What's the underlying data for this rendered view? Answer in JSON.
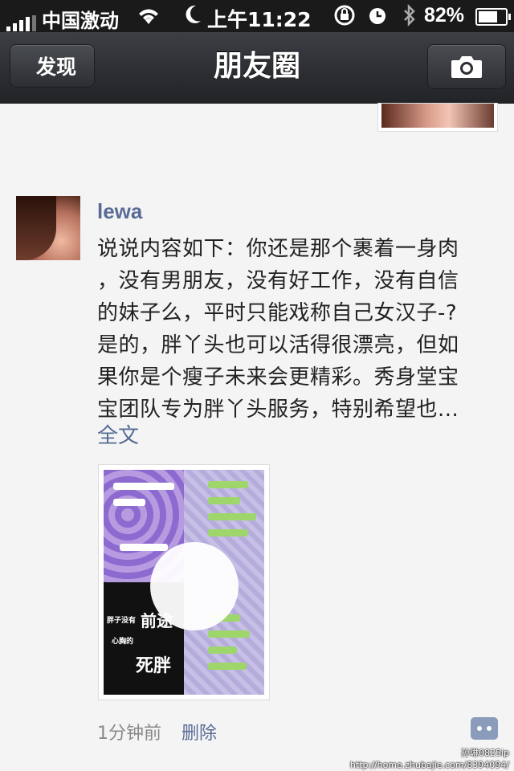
{
  "status_bar": {
    "carrier": "中国激动",
    "time": "上午11:22",
    "battery_percent": "82%",
    "battery_level": 0.82,
    "icons": [
      "signal-icon",
      "wifi-icon",
      "moon-icon",
      "rotation-lock-icon",
      "alarm-icon",
      "bluetooth-icon",
      "battery-icon"
    ]
  },
  "nav": {
    "back_label": "发现",
    "title": "朋友圈",
    "camera_icon": "camera-icon"
  },
  "post": {
    "username": "lewa",
    "text_lines": [
      "说说内容如下：你还是那个裹着一身肉",
      "，没有男朋友，没有好工作，没有自信",
      "的妹子么，平时只能戏称自己女汉子-?",
      "是的，胖丫头也可以活得很漂亮，但如",
      "果你是个瘦子未来会更精彩。秀身堂宝",
      "宝团队专为胖丫头服务，特别希望也..."
    ],
    "fulltext_label": "全文",
    "image_text": [
      "前途",
      "死胖",
      "胖子没有",
      "心胸的"
    ],
    "time": "1分钟前",
    "delete_label": "删除"
  },
  "watermark": {
    "line1": "孙琳0825ip",
    "line2": "http://home.zhubajie.com/8394094/"
  },
  "colors": {
    "link": "#576b95",
    "navbar": "#2b2d31",
    "background": "#f4f4f4"
  }
}
